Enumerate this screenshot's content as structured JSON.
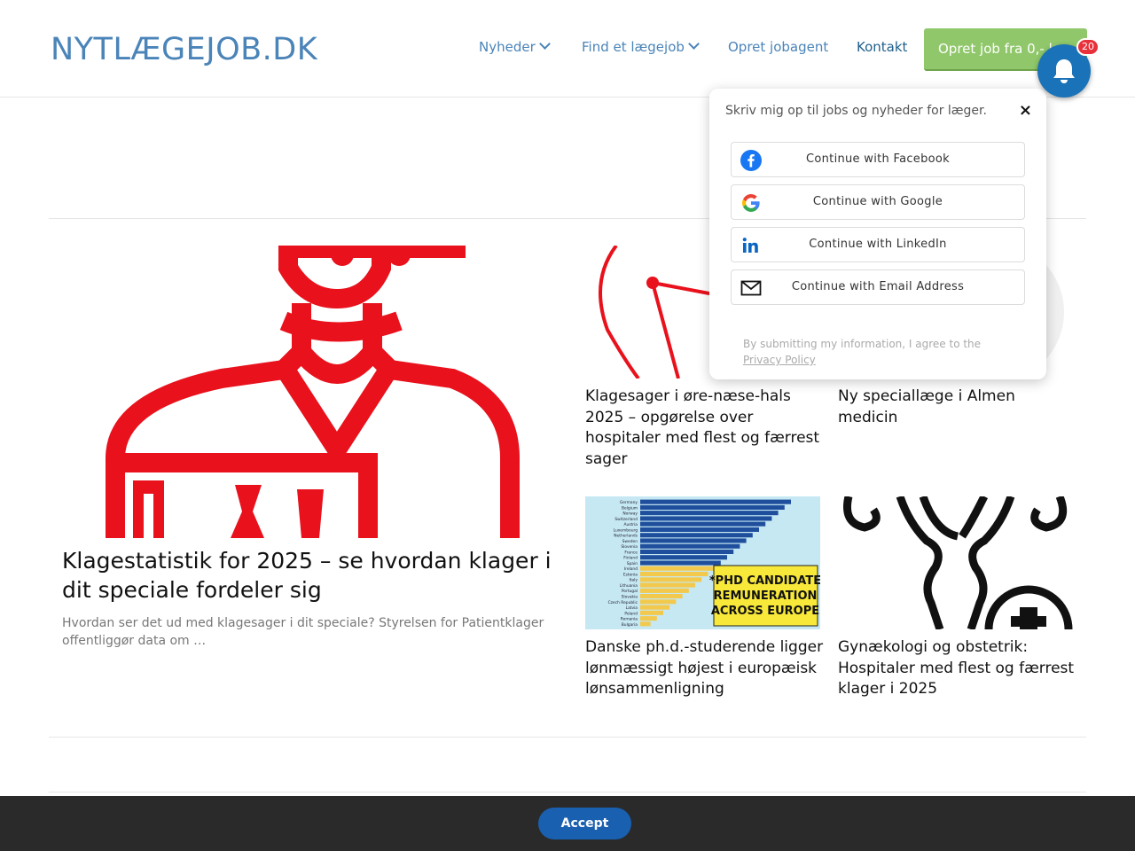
{
  "header": {
    "logo": "NYTLÆGEJOB.DK",
    "nav": [
      {
        "label": "Nyheder",
        "has_dropdown": true
      },
      {
        "label": "Find et lægejob",
        "has_dropdown": true
      },
      {
        "label": "Opret jobagent",
        "has_dropdown": false
      },
      {
        "label": "Kontakt",
        "has_dropdown": false
      }
    ],
    "cta_label": "Opret job fra 0,- kr"
  },
  "notification": {
    "icon": "bell-icon",
    "badge_count": "20"
  },
  "popup": {
    "title": "Skriv mig op til jobs og nyheder for læger.",
    "close_symbol": "×",
    "buttons": [
      {
        "label": "Continue with Facebook",
        "icon": "facebook-icon",
        "color": "#1877f2"
      },
      {
        "label": "Continue with Google",
        "icon": "google-icon",
        "color": "#4285f4"
      },
      {
        "label": "Continue with LinkedIn",
        "icon": "linkedin-icon",
        "color": "#0a66c2"
      },
      {
        "label": "Continue with Email Address",
        "icon": "email-icon",
        "color": "#222222"
      }
    ],
    "legal_prefix": "By submitting my information, I agree to the ",
    "legal_link": "Privacy Policy"
  },
  "articles": {
    "featured": {
      "title": "Klagestatistik for 2025 – se hvordan klager i dit speciale fordeler sig",
      "excerpt": "Hvordan ser det ud med klagesager i dit speciale? Styrelsen for Patientklager offentliggør data om …"
    },
    "cards": [
      {
        "title": "Klagesager i øre-næse-hals 2025 – opgørelse over hospitaler med flest og færrest sager"
      },
      {
        "title": "Ny speciallæge i Almen medicin"
      },
      {
        "title": "Danske ph.d.-studerende ligger lønmæssigt højest i europæisk lønsammenligning"
      },
      {
        "title": "Gynækologi og obstetrik: Hospitaler med flest og færrest klager i 2025"
      }
    ],
    "phd_image_text": [
      "*PHD CANDIDATE",
      "REMUNERATION",
      "ACROSS EUROPE"
    ],
    "phd_image_countries": [
      "Germany",
      "Belgium",
      "Norway",
      "Switzerland",
      "Austria",
      "Luxembourg",
      "Netherlands",
      "Sweden",
      "Slovenia",
      "France",
      "Finland",
      "Spain",
      "Ireland",
      "Estonia",
      "Italy",
      "Lithuania",
      "Portugal",
      "Slovakia",
      "Czech Republic",
      "Latvia",
      "Poland",
      "Romania",
      "Bulgaria"
    ]
  },
  "cookie": {
    "accept_label": "Accept"
  },
  "colors": {
    "brand_blue": "#4a84b8",
    "cta_green": "#8fc76a",
    "bell_blue": "#1a73b8",
    "badge_red": "#e8313b",
    "illustration_red": "#e8111c"
  }
}
